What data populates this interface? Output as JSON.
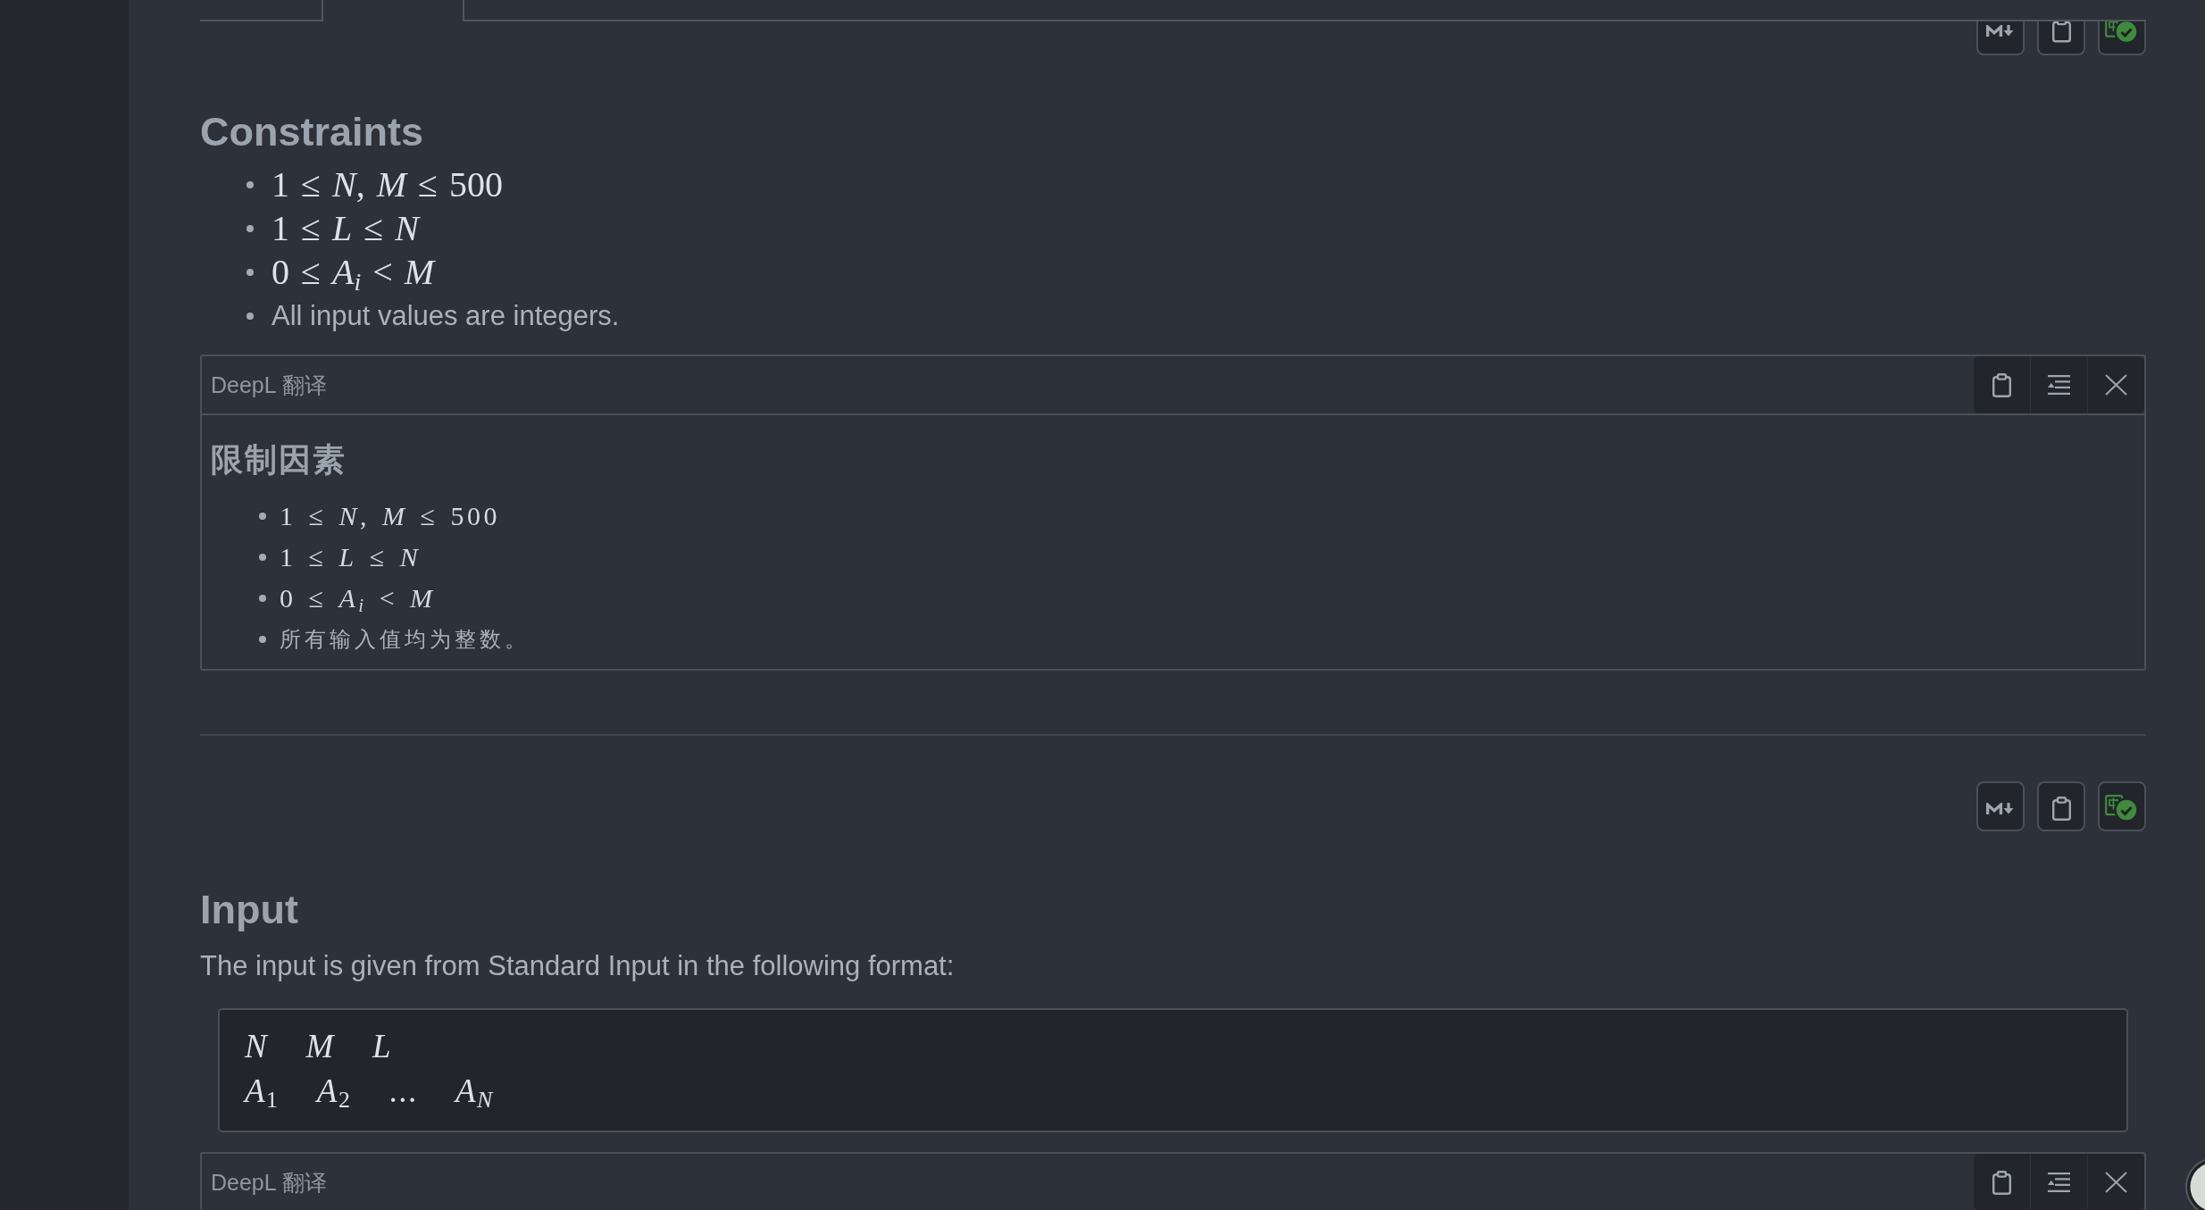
{
  "tabs": [
    {
      "selected": false
    },
    {
      "selected": true
    }
  ],
  "sections": [
    {
      "translated": true,
      "heading": "Constraints",
      "items": [
        {
          "kind": "math",
          "text": "1 ≤ *N*, *M* ≤ 500"
        },
        {
          "kind": "math",
          "text": "1 ≤ *L* ≤ *N*"
        },
        {
          "kind": "math",
          "text": "0 ≤ *A$_{i}$* < *M*"
        },
        {
          "kind": "text",
          "text": "All input values are integers."
        }
      ],
      "translation": {
        "label": "DeepL 翻译",
        "heading": "限制因素",
        "items": [
          {
            "kind": "math",
            "text": "1 ≤ *N*, *M* ≤ 500"
          },
          {
            "kind": "math",
            "text": "1 ≤ *L* ≤ *N*"
          },
          {
            "kind": "math",
            "text": "0 ≤ *A$_{i}$* < *M*"
          },
          {
            "kind": "text",
            "text": "所有输入值均为整数。"
          }
        ]
      }
    },
    {
      "translated": true,
      "heading": "Input",
      "paragraph": "The input is given from Standard Input in the following format:",
      "format_lines": [
        "*N* *M* *L*",
        "*A*$_{1}$ *A*$_{2}$ ... *A$_{N}$*"
      ],
      "translation": {
        "label": "DeepL 翻译"
      }
    }
  ]
}
